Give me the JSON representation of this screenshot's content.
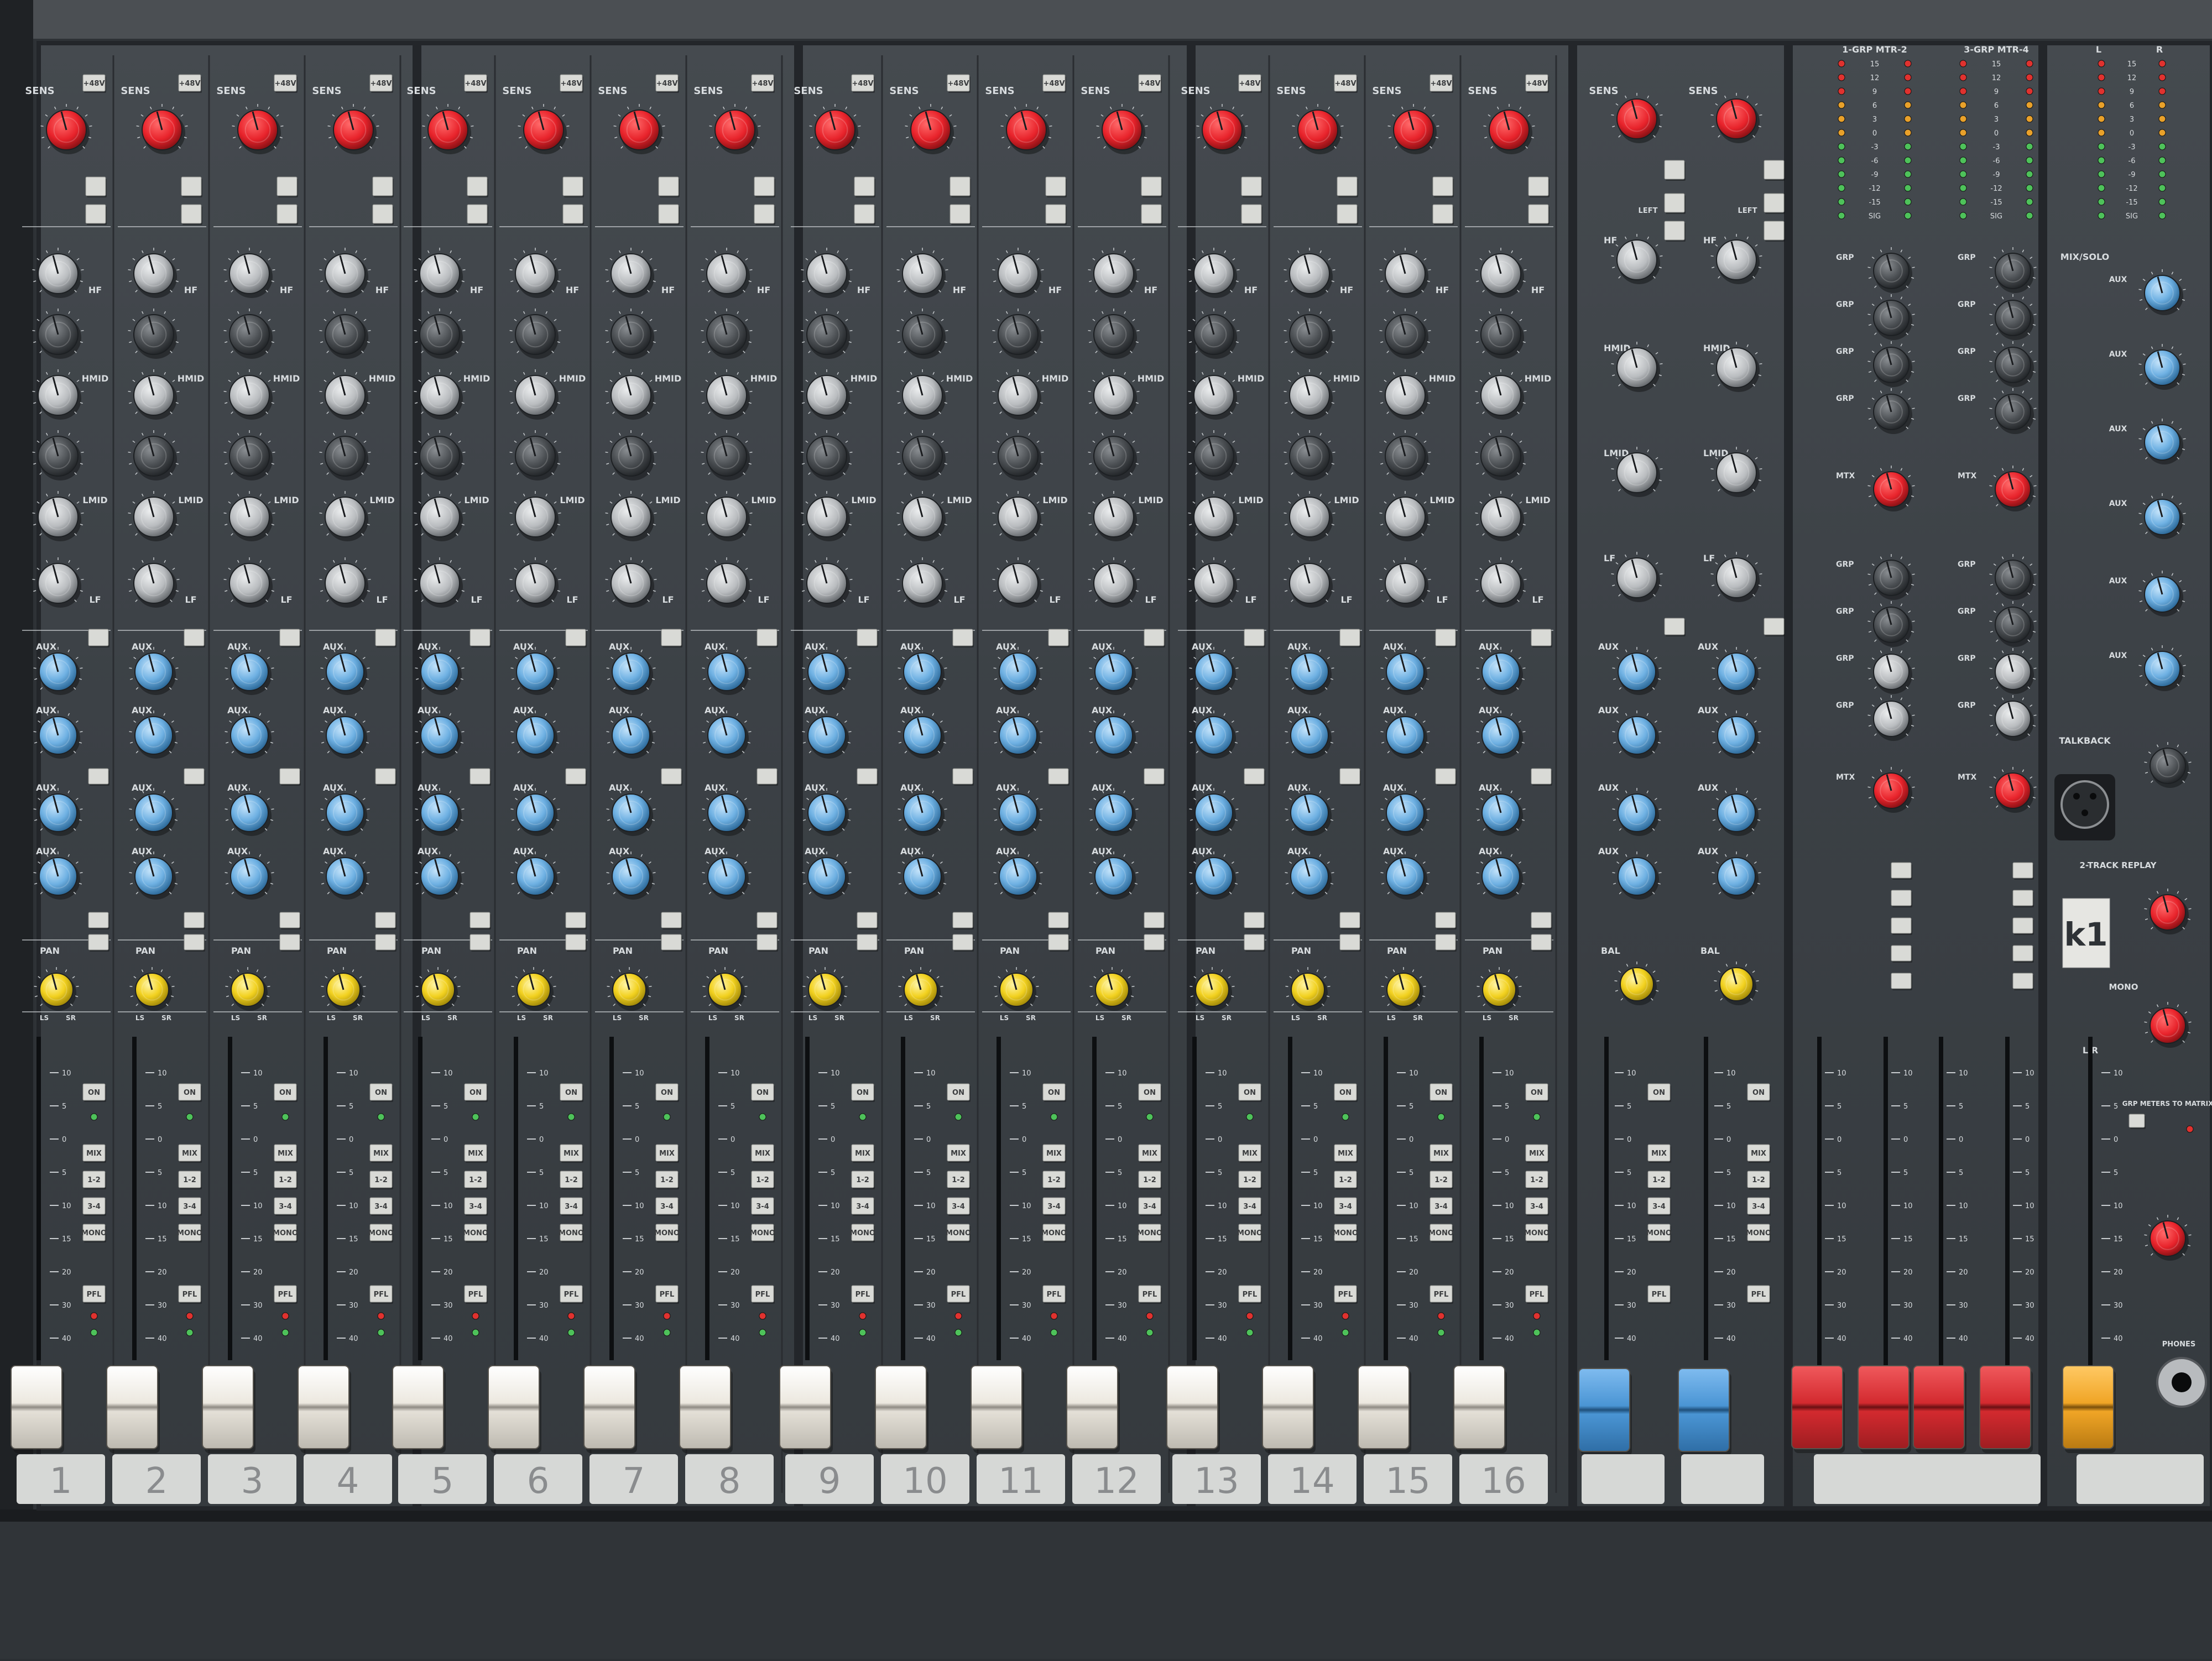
{
  "colors": {
    "panel": "#3d4247",
    "panel_dark": "#2a2e32",
    "frame": "#55595d",
    "label_text": "#d8dcdf",
    "knob_red": "#e8232b",
    "knob_grey": "#b9bcbf",
    "knob_dark": "#4a4e52",
    "knob_blue": "#6fb1e3",
    "knob_yellow": "#f2d11f",
    "fader_white": "#ece8df",
    "fader_blue": "#4a95d4",
    "fader_red": "#d32a2f",
    "fader_yellow": "#f0a526",
    "button": "#d9dad6",
    "led_green": "#4ec25a",
    "led_red": "#e0322f",
    "led_amber": "#e9a12a"
  },
  "channel_strip": {
    "sens_label": "SENS",
    "phantom_button": "+48V",
    "eq_labels": [
      "HF",
      "HMID",
      "LMID",
      "LF"
    ],
    "aux_label": "AUX",
    "pan_label": "PAN",
    "bal_label": "BAL",
    "on_button": "ON",
    "mix_button": "MIX",
    "route_buttons": [
      "1-2",
      "3-4"
    ],
    "mono_button": "MONO",
    "pfl_button": "PFL",
    "pan_scale": [
      "LS",
      "SR"
    ]
  },
  "channels": [
    {
      "number": "1"
    },
    {
      "number": "2"
    },
    {
      "number": "3"
    },
    {
      "number": "4"
    },
    {
      "number": "5"
    },
    {
      "number": "6"
    },
    {
      "number": "7"
    },
    {
      "number": "8"
    },
    {
      "number": "9"
    },
    {
      "number": "10"
    },
    {
      "number": "11"
    },
    {
      "number": "12"
    },
    {
      "number": "13"
    },
    {
      "number": "14"
    },
    {
      "number": "15"
    },
    {
      "number": "16"
    }
  ],
  "stereo_inputs": {
    "sens_label": "SENS",
    "eq_labels": [
      "HF",
      "HMID",
      "LMID",
      "LF"
    ],
    "bal_label": "BAL",
    "left_button": "LEFT"
  },
  "group_section": {
    "meter_titles": [
      "1-GRP MTR-2",
      "3-GRP MTR-4"
    ],
    "grp_label": "GRP",
    "mtx_label": "MTX",
    "meter_scale": [
      "15",
      "12",
      "9",
      "6",
      "3",
      "0",
      "-3",
      "-6",
      "-9",
      "-12",
      "-15",
      "SIG"
    ]
  },
  "master_section": {
    "mix_solo": "MIX/SOLO",
    "lr_labels": [
      "L",
      "R"
    ],
    "aux_label": "AUX",
    "talkback": "TALKBACK",
    "two_track": "2-TRACK REPLAY",
    "logo": "k1",
    "mono": "MONO",
    "lr_fader": "L/R",
    "grp_meters": "GRP METERS TO MATRIX",
    "phones": "PHONES"
  },
  "fader_scale": [
    "10",
    "5",
    "0",
    "5",
    "10",
    "15",
    "20",
    "30",
    "40"
  ]
}
